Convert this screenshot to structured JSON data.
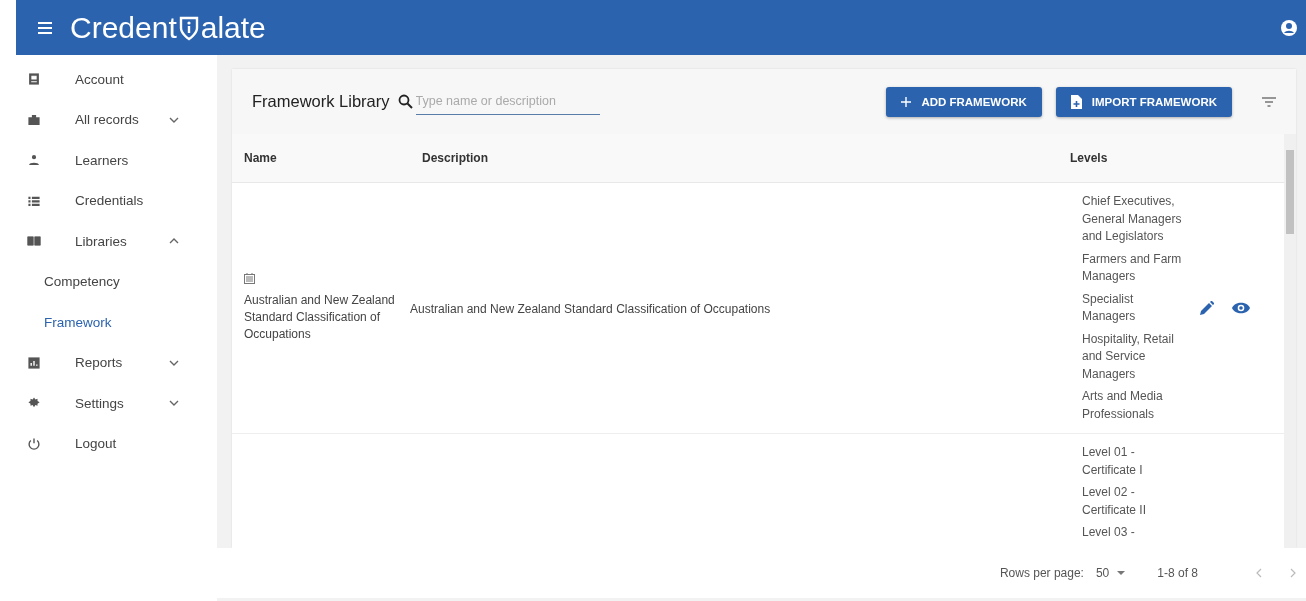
{
  "app_bar": {
    "logo": [
      "Credent",
      "alate"
    ]
  },
  "sidebar": {
    "items": [
      {
        "label": "Account"
      },
      {
        "label": "All records",
        "expanded": false
      },
      {
        "label": "Learners"
      },
      {
        "label": "Credentials"
      },
      {
        "label": "Libraries",
        "expanded": true,
        "children": [
          {
            "label": "Competency",
            "selected": false
          },
          {
            "label": "Framework",
            "selected": true
          }
        ]
      },
      {
        "label": "Reports",
        "expanded": false
      },
      {
        "label": "Settings",
        "expanded": false
      },
      {
        "label": "Logout"
      }
    ]
  },
  "toolbar": {
    "title": "Framework Library",
    "search": {
      "placeholder": "Type name or description"
    },
    "buttons": [
      {
        "label": "ADD FRAMEWORK"
      },
      {
        "label": "IMPORT FRAMEWORK"
      }
    ]
  },
  "table": {
    "columns": [
      "Name",
      "Description",
      "Levels"
    ],
    "rows": [
      {
        "name": "Australian and New Zealand Standard Classification of Occupations",
        "has_icon": true,
        "description": "Australian and New Zealand Standard Classification of Occupations",
        "levels": [
          "Chief Executives, General Managers and Legislators",
          "Farmers and Farm Managers",
          "Specialist Managers",
          "Hospitality, Retail and Service Managers",
          "Arts and Media Professionals"
        ],
        "actions": true
      },
      {
        "has_icon": false,
        "levels": [
          "Level 01 - Certificate I",
          "Level 02 - Certificate II",
          "Level 03 -"
        ],
        "actions": false
      }
    ]
  },
  "pagination": {
    "rows_per_page_label": "Rows per page:",
    "rows_per_page": "50",
    "range": "1-8 of 8"
  }
}
